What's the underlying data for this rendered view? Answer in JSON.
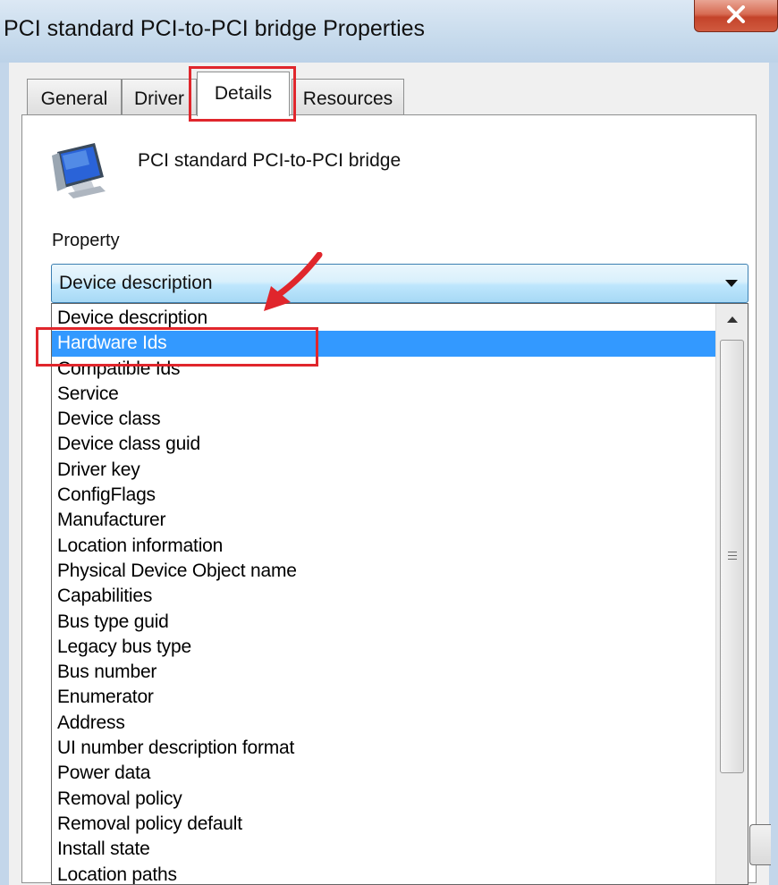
{
  "window": {
    "title": "PCI standard PCI-to-PCI bridge Properties",
    "close_label": "X"
  },
  "tabs": [
    {
      "label": "General",
      "active": false
    },
    {
      "label": "Driver",
      "active": false
    },
    {
      "label": "Details",
      "active": true
    },
    {
      "label": "Resources",
      "active": false
    }
  ],
  "device": {
    "icon": "monitor-device-icon",
    "name": "PCI standard PCI-to-PCI bridge"
  },
  "property": {
    "label": "Property",
    "selected_value": "Device description",
    "options": [
      "Device description",
      "Hardware Ids",
      "Compatible Ids",
      "Service",
      "Device class",
      "Device class guid",
      "Driver key",
      "ConfigFlags",
      "Manufacturer",
      "Location information",
      "Physical Device Object name",
      "Capabilities",
      "Bus type guid",
      "Legacy bus type",
      "Bus number",
      "Enumerator",
      "Address",
      "UI number description format",
      "Power data",
      "Removal policy",
      "Removal policy default",
      "Install state",
      "Location paths"
    ],
    "highlighted_option": "Hardware Ids"
  },
  "annotations": {
    "color": "#e0262c",
    "highlights": [
      "Details",
      "Hardware Ids"
    ]
  },
  "colors": {
    "selection": "#3399ff",
    "combo_border": "#3c7fb1"
  }
}
